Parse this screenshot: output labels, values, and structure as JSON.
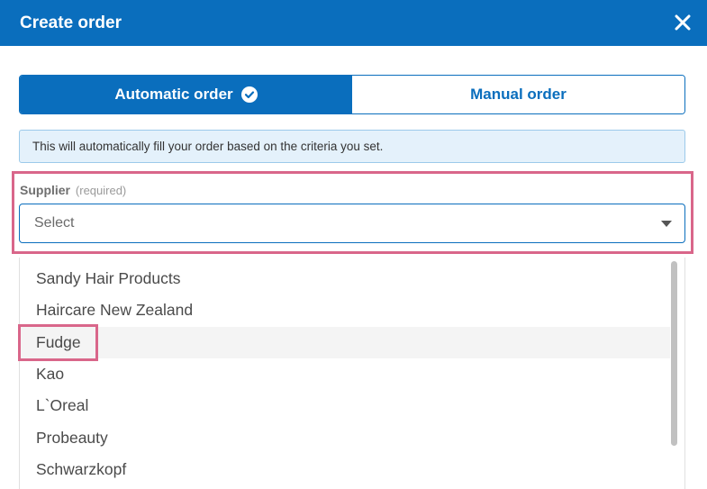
{
  "dialog": {
    "title": "Create order",
    "close_icon": "close-icon"
  },
  "toggle": {
    "automatic_label": "Automatic order",
    "manual_label": "Manual order",
    "active": "automatic"
  },
  "info": {
    "text": "This will automatically fill your order based on the criteria you set."
  },
  "supplier": {
    "label": "Supplier",
    "required_note": "(required)",
    "selected_value": "Select",
    "options": [
      "Sandy Hair Products",
      "Haircare New Zealand",
      "Fudge",
      "Kao",
      "L`Oreal",
      "Probeauty",
      "Schwarzkopf"
    ],
    "hovered_option": "Fudge"
  },
  "colors": {
    "primary": "#0a6ebd",
    "highlight": "#d9668a",
    "info_bg": "#e4f1fb"
  }
}
